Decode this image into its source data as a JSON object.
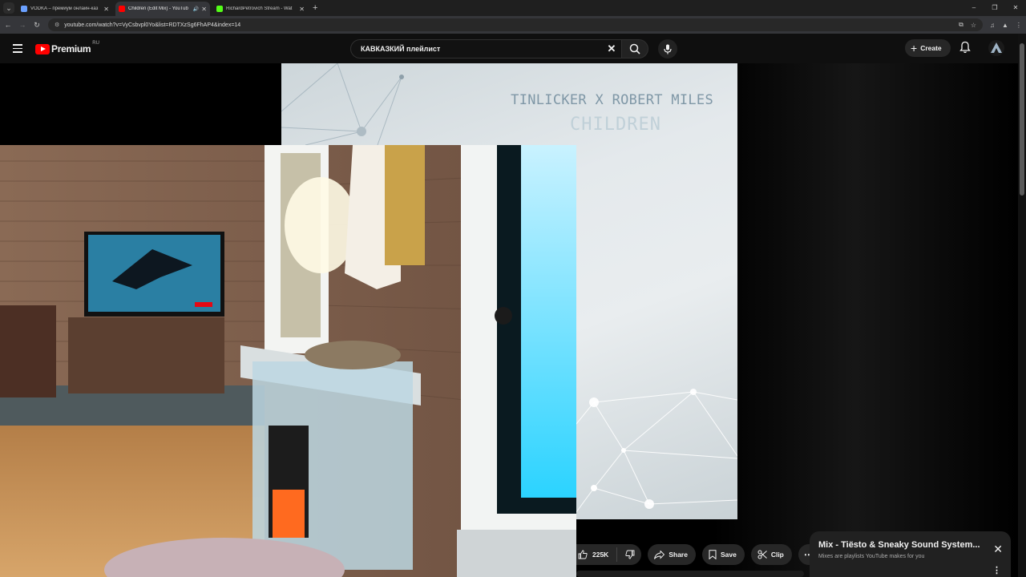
{
  "browser": {
    "tabs": [
      {
        "title": "VODKA – премиум онлайн-каз",
        "favicon_color": "#6aa0ff",
        "active": false
      },
      {
        "title": "Children (Edit Mix) - YouTub",
        "favicon_color": "#ff0000",
        "active": true
      },
      {
        "title": "RichardPetrovich Stream - Wat",
        "favicon_color": "#53fc18",
        "active": false
      }
    ],
    "new_tab_label": "+",
    "url": "youtube.com/watch?v=VyCsbvpl0Yo&list=RDTXzSg6FhAP4&index=14",
    "window_controls": [
      "–",
      "❐",
      "✕"
    ]
  },
  "masthead": {
    "logo_word": "Premium",
    "country_code": "RU",
    "search_query": "КАВКАЗКИЙ плейлист",
    "create_label": "Create"
  },
  "video": {
    "artist_text": "TINLICKER X ROBERT MILES",
    "track_text": "CHILDREN"
  },
  "actions": {
    "like_count": "225K",
    "share_label": "Share",
    "save_label": "Save",
    "clip_label": "Clip"
  },
  "mix_card": {
    "title": "Mix - Tiësto & Sneaky Sound System...",
    "subtitle": "Mixes are playlists YouTube makes for you"
  },
  "colors": {
    "youtube_red": "#ff0000",
    "page_bg": "#0f0f0f",
    "chip_bg": "#272727"
  }
}
